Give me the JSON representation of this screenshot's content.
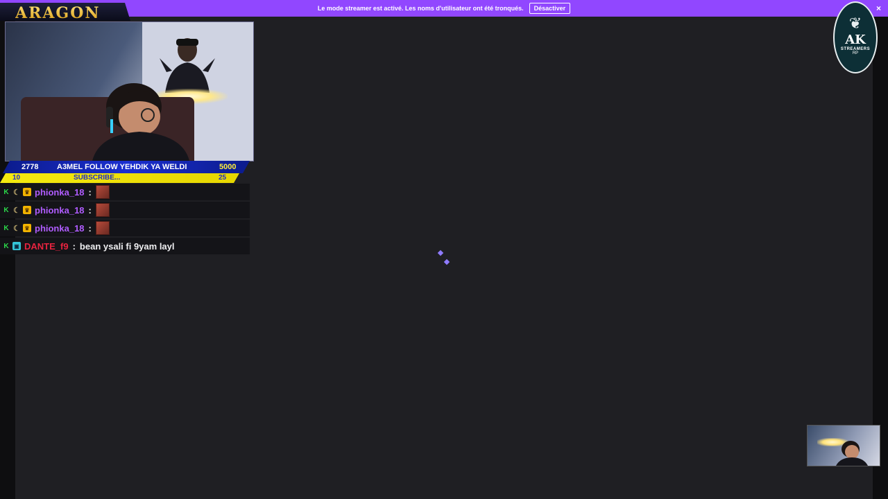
{
  "banner": {
    "message": "Le mode streamer est activé. Les noms d'utilisateur ont été tronqués.",
    "button": "Désactiver",
    "close": "×"
  },
  "brand": {
    "logo_text": "ARAGON"
  },
  "goal": {
    "current": "2778",
    "label": "A3MEL FOLLOW YEHDIK YA WELDI",
    "target": "5000",
    "sub_current": "10",
    "sub_label": "SUBSCRIBE...",
    "sub_target": "25"
  },
  "chat": {
    "messages": [
      {
        "user": "phionka_18",
        "color": "#b05cff",
        "badges": [
          "k-icon",
          "moon-icon",
          "crown-icon"
        ],
        "emote": true,
        "text": ""
      },
      {
        "user": "phionka_18",
        "color": "#b05cff",
        "badges": [
          "k-icon",
          "moon-icon",
          "crown-icon"
        ],
        "emote": true,
        "text": ""
      },
      {
        "user": "phionka_18",
        "color": "#b05cff",
        "badges": [
          "k-icon",
          "moon-icon",
          "crown-icon"
        ],
        "emote": true,
        "text": ""
      },
      {
        "user": "DANTE_f9",
        "color": "#e8233f",
        "badges": [
          "k-icon",
          "gamepad-icon"
        ],
        "emote": false,
        "text": "bean ysali fi 9yam layl"
      }
    ]
  },
  "channel_logo": {
    "glyph": "AK",
    "sub": "STREAMERS",
    "sub2": "RP"
  },
  "colors": {
    "banner_bg": "#9147ff",
    "page_bg": "#1f1f23",
    "goal_blue": "#1b2fd0",
    "goal_yellow": "#f5ea10",
    "loader": "#8f7bff"
  }
}
